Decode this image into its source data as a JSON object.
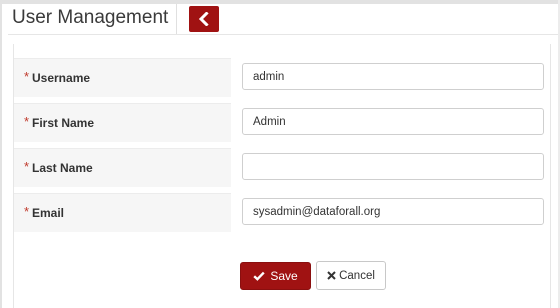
{
  "header": {
    "title": "User Management",
    "back_icon": "chevron-left-icon"
  },
  "form": {
    "required_marker": "*",
    "fields": [
      {
        "label": "Username",
        "value": "admin"
      },
      {
        "label": "First Name",
        "value": "Admin"
      },
      {
        "label": "Last Name",
        "value": ""
      },
      {
        "label": "Email",
        "value": "sysadmin@dataforall.org"
      }
    ]
  },
  "actions": {
    "save_label": "Save",
    "save_icon": "checkmark-icon",
    "cancel_label": "Cancel",
    "cancel_icon": "x-icon"
  },
  "colors": {
    "accent": "#a01212",
    "required": "#c0392b",
    "label_bg": "#f6f6f6"
  }
}
